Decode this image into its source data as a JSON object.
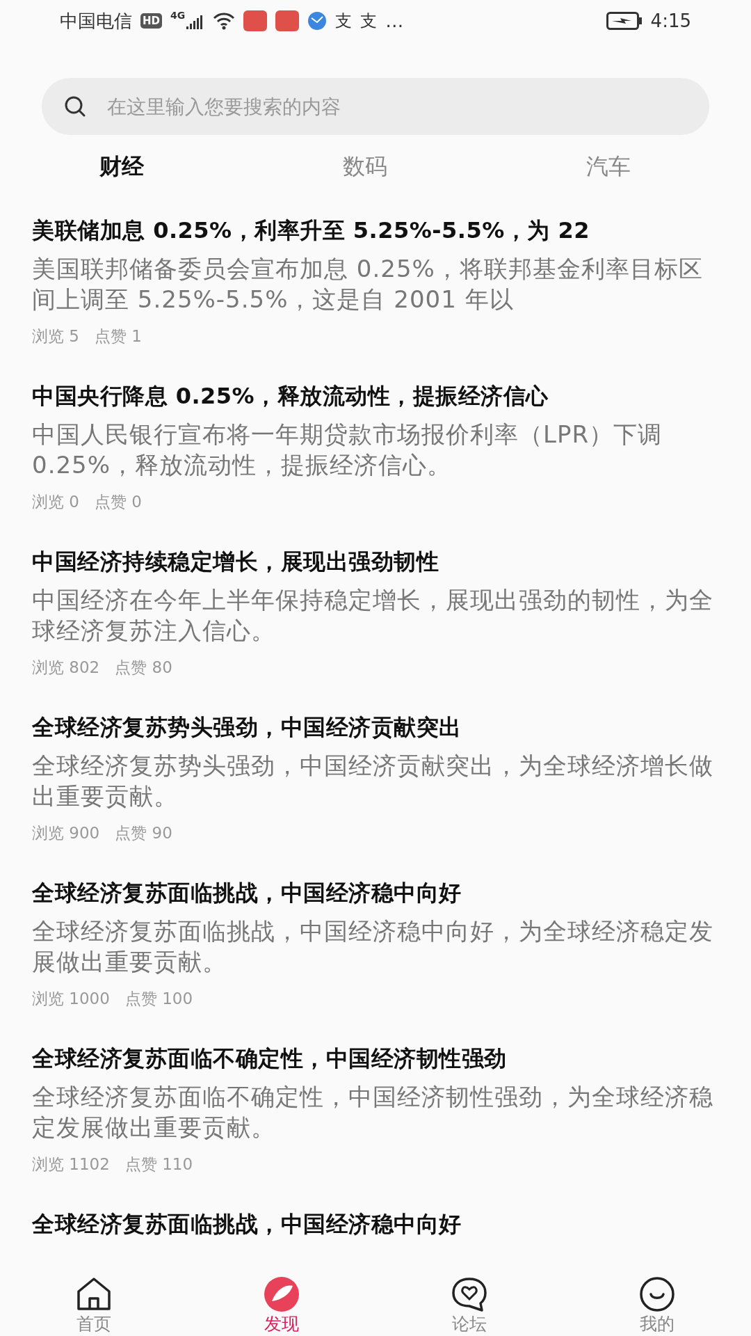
{
  "status_bar": {
    "carrier": "中国电信",
    "hd": "HD",
    "network": "4G",
    "notifications": [
      "支",
      "支"
    ],
    "more": "…",
    "time": "4:15"
  },
  "search": {
    "placeholder": "在这里输入您要搜索的内容"
  },
  "tabs": [
    {
      "label": "财经",
      "selected": true
    },
    {
      "label": "数码",
      "selected": false
    },
    {
      "label": "汽车",
      "selected": false
    }
  ],
  "articles": [
    {
      "title": "美联储加息 0.25%，利率升至 5.25%-5.5%，为 22",
      "summary": "美国联邦储备委员会宣布加息 0.25%，将联邦基金利率目标区间上调至 5.25%-5.5%，这是自 2001 年以",
      "views": "浏览 5",
      "likes": "点赞 1"
    },
    {
      "title": "中国央行降息 0.25%，释放流动性，提振经济信心",
      "summary": "中国人民银行宣布将一年期贷款市场报价利率（LPR）下调 0.25%，释放流动性，提振经济信心。",
      "views": "浏览 0",
      "likes": "点赞 0"
    },
    {
      "title": "中国经济持续稳定增长，展现出强劲韧性",
      "summary": "中国经济在今年上半年保持稳定增长，展现出强劲的韧性，为全球经济复苏注入信心。",
      "views": "浏览 802",
      "likes": "点赞 80"
    },
    {
      "title": "全球经济复苏势头强劲，中国经济贡献突出",
      "summary": "全球经济复苏势头强劲，中国经济贡献突出，为全球经济增长做出重要贡献。",
      "views": "浏览 900",
      "likes": "点赞 90"
    },
    {
      "title": "全球经济复苏面临挑战，中国经济稳中向好",
      "summary": "全球经济复苏面临挑战，中国经济稳中向好，为全球经济稳定发展做出重要贡献。",
      "views": "浏览 1000",
      "likes": "点赞 100"
    },
    {
      "title": "全球经济复苏面临不确定性，中国经济韧性强劲",
      "summary": "全球经济复苏面临不确定性，中国经济韧性强劲，为全球经济稳定发展做出重要贡献。",
      "views": "浏览 1102",
      "likes": "点赞 110"
    },
    {
      "title": "全球经济复苏面临挑战，中国经济稳中向好"
    }
  ],
  "nav": [
    {
      "kind": "home",
      "label": "首页",
      "selected": false
    },
    {
      "kind": "discover",
      "label": "发现",
      "selected": true
    },
    {
      "kind": "forum",
      "label": "论坛",
      "selected": false
    },
    {
      "kind": "me",
      "label": "我的",
      "selected": false
    }
  ]
}
